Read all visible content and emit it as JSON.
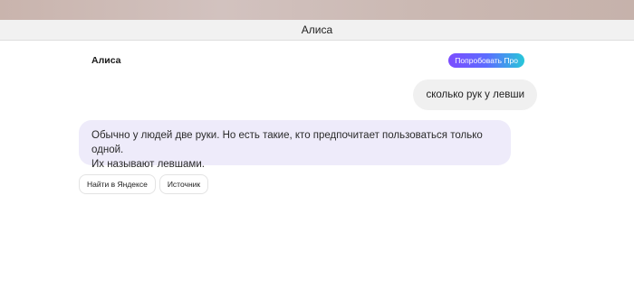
{
  "window": {
    "title": "Алиса"
  },
  "header": {
    "assistant_name": "Алиса",
    "pro_button_label": "Попробовать Про"
  },
  "messages": {
    "user": "сколько рук у левши",
    "assistant_lines": [
      "Обычно у людей две руки. Но есть такие, кто предпочитает пользоваться только одной.",
      "Их называют левшами."
    ]
  },
  "actions": [
    {
      "label": "Найти в Яндексе"
    },
    {
      "label": "Источник"
    }
  ],
  "colors": {
    "assistant_bubble": "#eeebfa",
    "user_bubble": "#f0f0f0",
    "pro_gradient_start": "#7c4dff",
    "pro_gradient_end": "#27c7d9"
  }
}
